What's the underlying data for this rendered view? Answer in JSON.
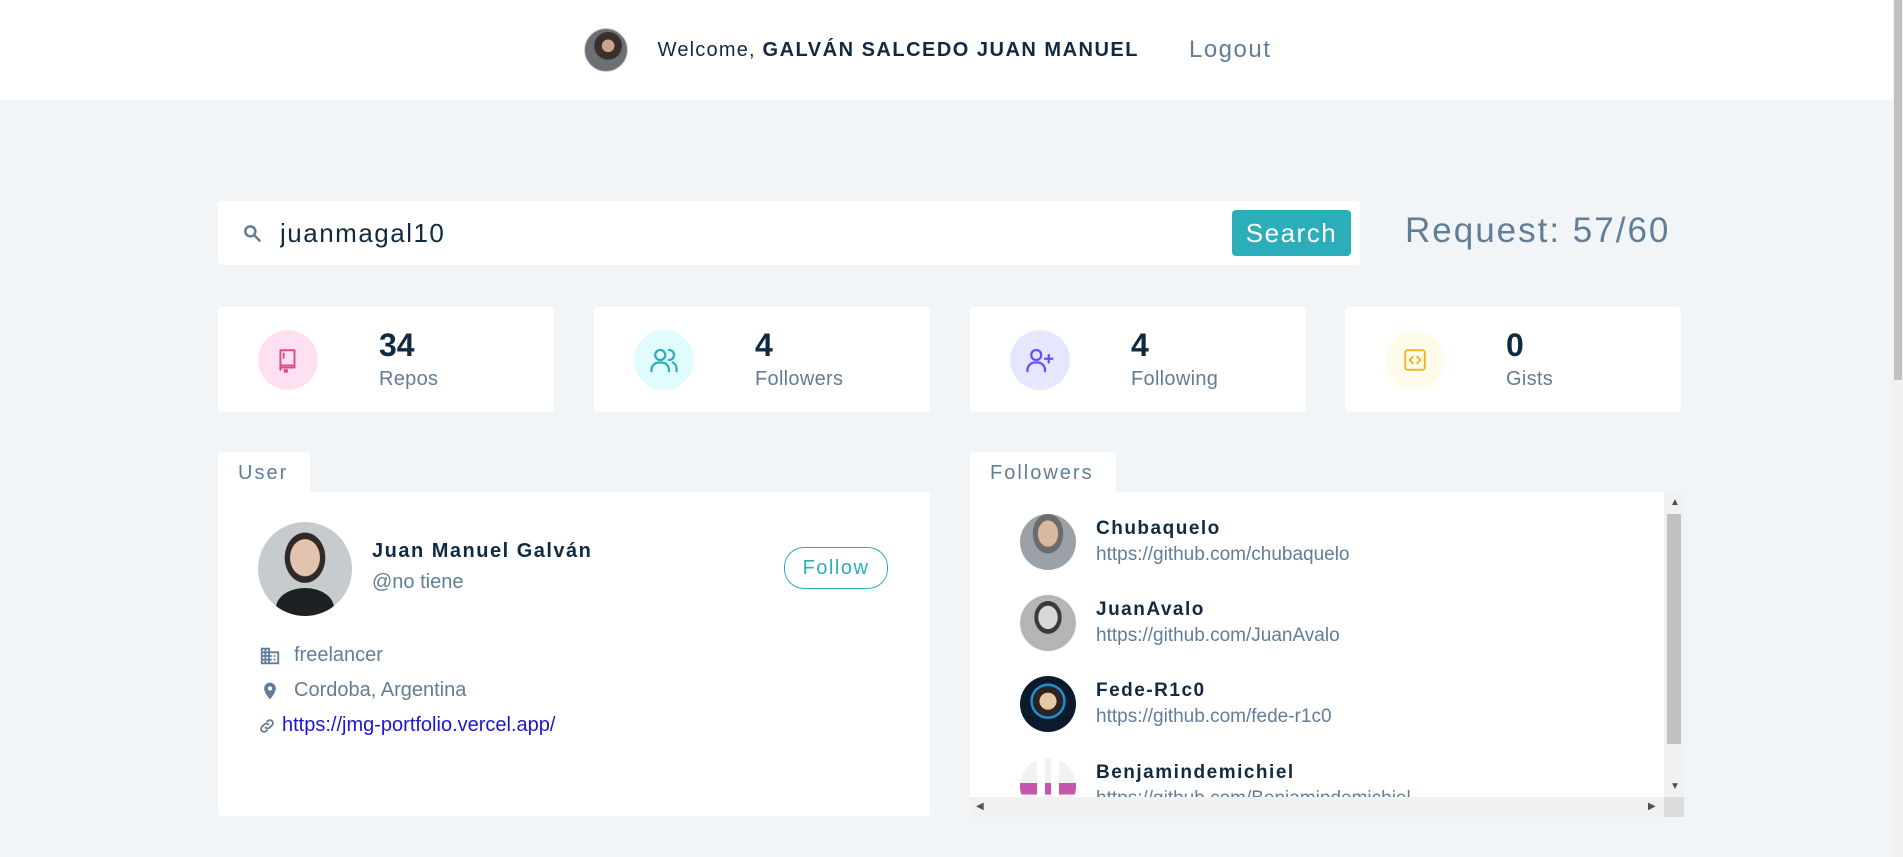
{
  "navbar": {
    "welcome_prefix": "Welcome,",
    "user_name": "GALVÁN SALCEDO JUAN MANUEL",
    "logout_label": "Logout"
  },
  "search": {
    "value": "juanmagal10",
    "button_label": "Search",
    "request_text": "Request: 57/60"
  },
  "stats": [
    {
      "value": "34",
      "label": "Repos",
      "icon": "repo-book-icon",
      "bg": "#ffe0f0",
      "color": "#da4a91"
    },
    {
      "value": "4",
      "label": "Followers",
      "icon": "users-icon",
      "bg": "#e0fcff",
      "color": "#2caeba"
    },
    {
      "value": "4",
      "label": "Following",
      "icon": "user-plus-icon",
      "bg": "#e6e6ff",
      "color": "#5d55fa"
    },
    {
      "value": "0",
      "label": "Gists",
      "icon": "code-icon",
      "bg": "#fffbea",
      "color": "#f0b429"
    }
  ],
  "user": {
    "tab_label": "User",
    "name": "Juan Manuel Galván",
    "handle": "@no tiene",
    "follow_label": "Follow",
    "company": "freelancer",
    "location": "Cordoba, Argentina",
    "blog": "https://jmg-portfolio.vercel.app/"
  },
  "followers": {
    "tab_label": "Followers",
    "items": [
      {
        "name": "Chubaquelo",
        "url": "https://github.com/chubaquelo"
      },
      {
        "name": "JuanAvalo",
        "url": "https://github.com/JuanAvalo"
      },
      {
        "name": "Fede-R1c0",
        "url": "https://github.com/fede-r1c0"
      },
      {
        "name": "Benjamindemichiel",
        "url": "https://github.com/Benjamindemichiel"
      }
    ]
  },
  "colors": {
    "accent": "#2caeba",
    "background": "#f1f5f8",
    "text_dark": "#102a42",
    "text_muted": "#617d98",
    "link": "#1a16d9"
  }
}
